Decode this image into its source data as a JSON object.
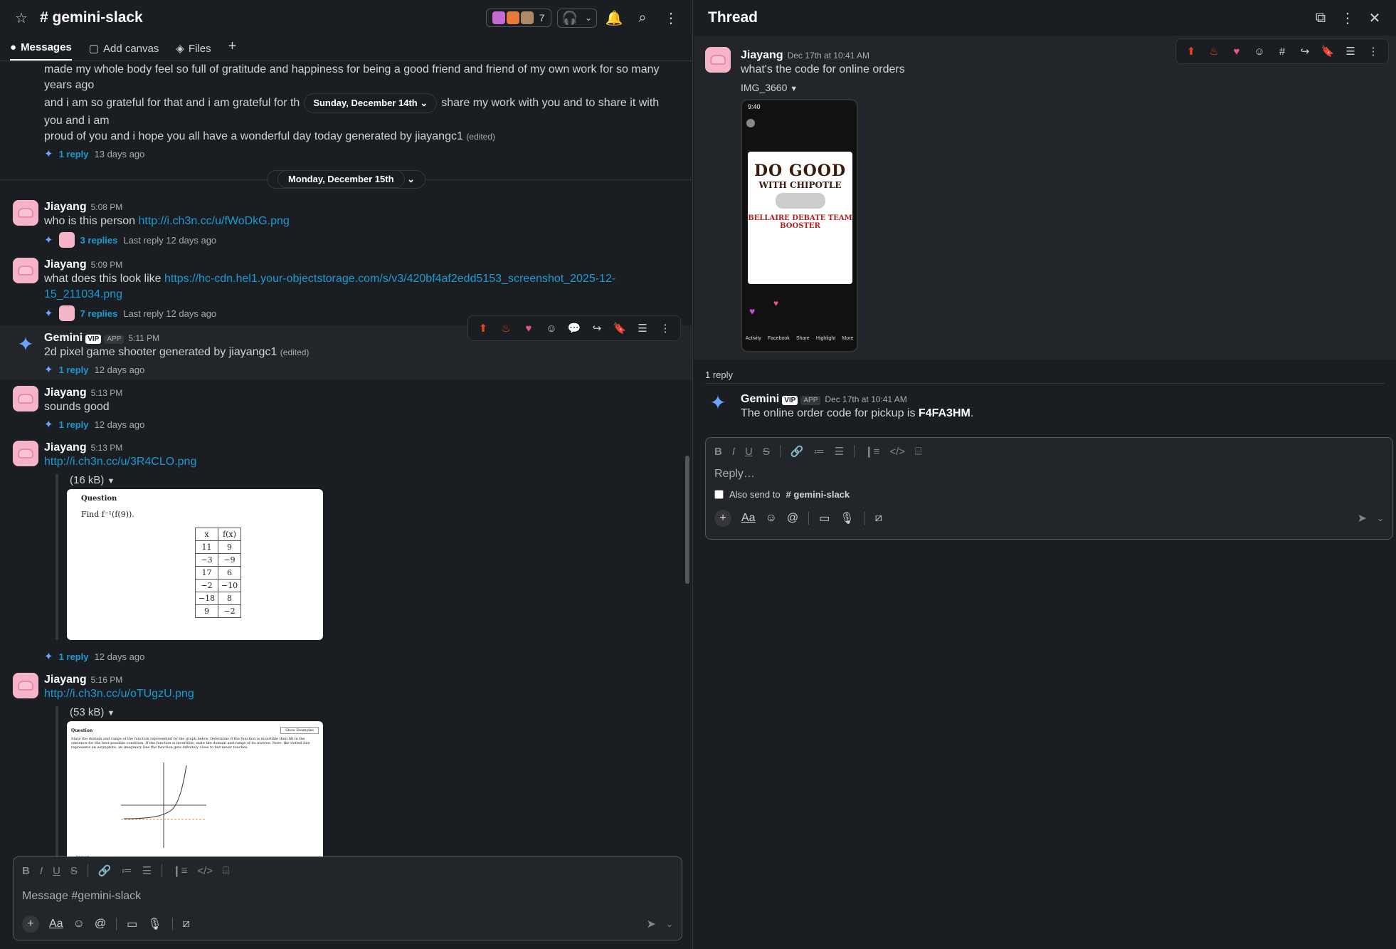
{
  "channel": {
    "name": "# gemini-slack",
    "member_count": "7",
    "tabs": [
      {
        "label": "Messages"
      },
      {
        "label": "Add canvas"
      },
      {
        "label": "Files"
      }
    ],
    "top_snippet": {
      "line1": "made my whole body feel so full of gratitude and happiness for being a good friend and friend of my own work for so many years ago",
      "line2a": "and i am so grateful for that and i am grateful for th",
      "line2b": "share my work with you and to share it with you and i am",
      "line3": "proud of you and i hope you all have a wonderful day today generated by jiayangc1",
      "edited": "(edited)",
      "reply": "1 reply",
      "reply_time": "13 days ago",
      "date_pill": "Sunday, December 14th"
    },
    "divider": "Monday, December 15th",
    "messages": [
      {
        "name": "Jiayang",
        "time": "5:08 PM",
        "text": "who is this person ",
        "link": "http://i.ch3n.cc/u/fWoDkG.png",
        "replies": "3 replies",
        "last": "Last reply 12 days ago"
      },
      {
        "name": "Jiayang",
        "time": "5:09 PM",
        "text": "what does this look like ",
        "link": "https://hc-cdn.hel1.your-objectstorage.com/s/v3/420bf4af2edd5153_screenshot_2025-12-15_211034.png",
        "replies": "7 replies",
        "last": "Last reply 12 days ago"
      },
      {
        "name": "Gemini",
        "badge": "VIP",
        "app": "APP",
        "time": "5:11 PM",
        "text": "2d pixel game shooter generated by jiayangc1",
        "edited": "(edited)",
        "replies": "1 reply",
        "last": "12 days ago"
      },
      {
        "name": "Jiayang",
        "time": "5:13 PM",
        "text": "sounds good",
        "replies": "1 reply",
        "last": "12 days ago"
      },
      {
        "name": "Jiayang",
        "time": "5:13 PM",
        "link": "http://i.ch3n.cc/u/3R4CLO.png",
        "size": "(16 kB)",
        "replies": "1 reply",
        "last": "12 days ago"
      },
      {
        "name": "Jiayang",
        "time": "5:16 PM",
        "link": "http://i.ch3n.cc/u/oTUgzU.png",
        "size": "(53 kB)"
      }
    ],
    "question1": {
      "heading": "Question",
      "prompt": "Find f⁻¹(f(9)).",
      "col_x": "x",
      "col_f": "f(x)",
      "rows": [
        [
          "11",
          "9"
        ],
        [
          "−3",
          "−9"
        ],
        [
          "17",
          "6"
        ],
        [
          "−2",
          "−10"
        ],
        [
          "−18",
          "8"
        ],
        [
          "9",
          "−2"
        ]
      ]
    },
    "question2": {
      "heading": "Question",
      "button": "Show Examples",
      "prompt": "State the domain and range of the function represented by the graph below. Determine if the function is invertible then fill in the sentence for the best possible condition. If the function is invertible, state the domain and range of its inverse. Note: the dotted line represents an asymptote, an imaginary line the function gets infinitely close to but never touches.",
      "footer": "Answer"
    },
    "composer_placeholder": "Message #gemini-slack"
  },
  "thread": {
    "title": "Thread",
    "parent": {
      "name": "Jiayang",
      "time": "Dec 17th at 10:41 AM",
      "text": "what's the code for online orders",
      "file": "IMG_3660"
    },
    "phone": {
      "clock": "9:40",
      "poster_big": "DO GOOD",
      "poster_with": "WITH CHIPOTLE",
      "poster_event": "BELLAIRE DEBATE TEAM",
      "poster_event2": "BOOSTER",
      "nav": [
        "Activity",
        "Facebook",
        "Share",
        "Highlight",
        "More"
      ]
    },
    "reply_count": "1 reply",
    "reply": {
      "name": "Gemini",
      "badge": "VIP",
      "app": "APP",
      "time": "Dec 17th at 10:41 AM",
      "text": "The online order code for pickup is ",
      "code": "F4FA3HM",
      "period": "."
    },
    "composer_placeholder": "Reply…",
    "also_send": "Also send to",
    "also_channel": "# gemini-slack"
  },
  "colors": {
    "bg": "#1a1d21",
    "link": "#1d9bd1",
    "accent": "#6ba4ff"
  }
}
